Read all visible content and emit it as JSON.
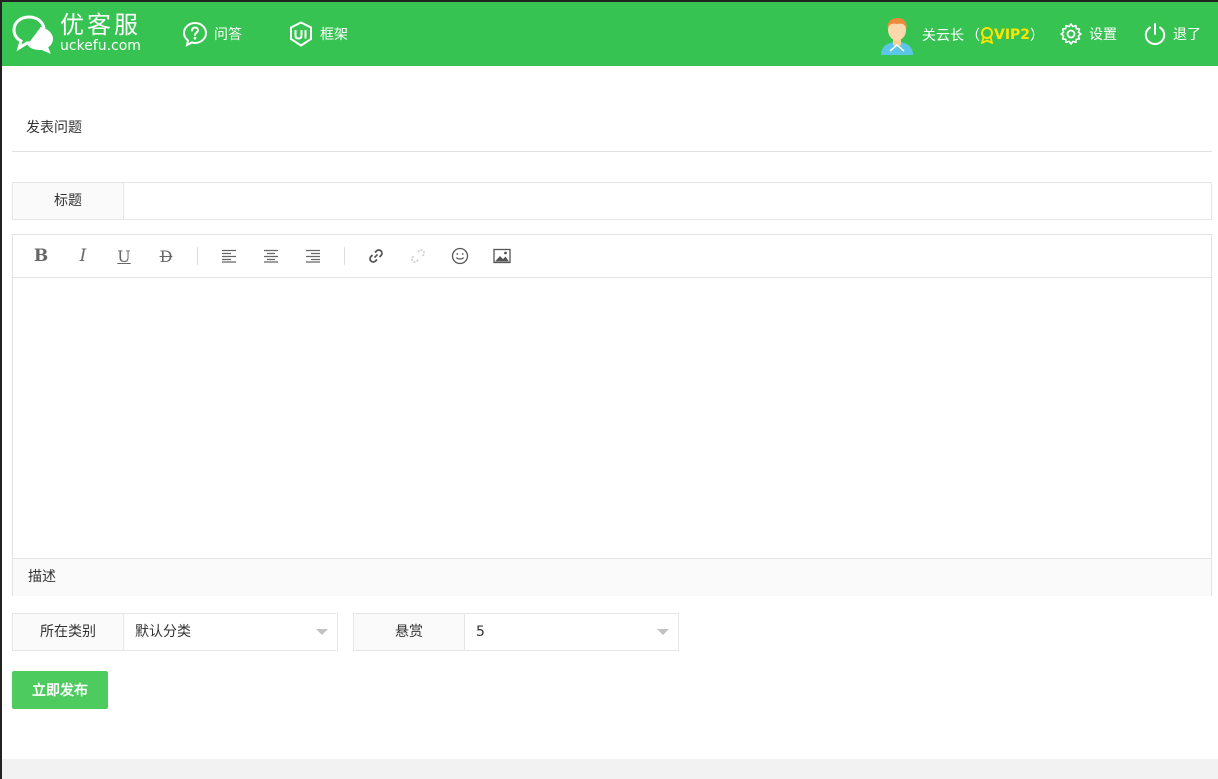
{
  "header": {
    "logo_cn": "优客服",
    "logo_en": "uckefu.com",
    "nav": [
      {
        "label": "问答",
        "icon": "question-bubble-icon"
      },
      {
        "label": "框架",
        "icon": "ui-badge-icon"
      }
    ],
    "user": {
      "name": "关云长",
      "open_paren": "（",
      "vip": "VIP2",
      "close_paren": "）"
    },
    "settings_label": "设置",
    "logout_label": "退了",
    "colors": {
      "bar": "#37c352",
      "vip": "#ffe400"
    }
  },
  "page": {
    "title": "发表问题"
  },
  "form": {
    "title_label": "标题",
    "title_value": "",
    "title_placeholder": "",
    "toolbar": [
      "bold-icon",
      "italic-icon",
      "underline-icon",
      "strikethrough-icon",
      "align-left-icon",
      "align-center-icon",
      "align-right-icon",
      "link-icon",
      "unlink-icon",
      "emoji-icon",
      "image-icon"
    ],
    "description_label": "描述",
    "category_label": "所在类别",
    "category_value": "默认分类",
    "reward_label": "悬赏",
    "reward_value": "5",
    "submit_label": "立即发布",
    "submit_color": "#4ecb5f"
  }
}
